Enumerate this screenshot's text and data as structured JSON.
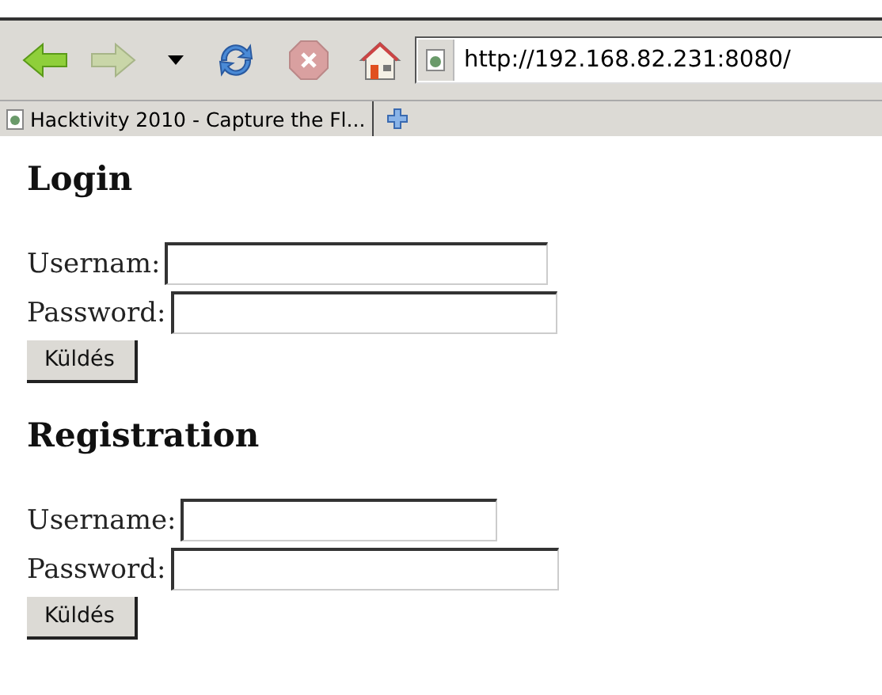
{
  "toolbar": {
    "url": "http://192.168.82.231:8080/"
  },
  "tabs": [
    {
      "label": "Hacktivity 2010 - Capture the Fl...",
      "selected": true
    }
  ],
  "forms": [
    {
      "title": "Login",
      "fields": [
        {
          "label": "Usernam:"
        },
        {
          "label": "Password:"
        }
      ],
      "button": "Küldés"
    },
    {
      "title": "Registration",
      "fields": [
        {
          "label": "Username:"
        },
        {
          "label": "Password:"
        }
      ],
      "button": "Küldés"
    }
  ]
}
